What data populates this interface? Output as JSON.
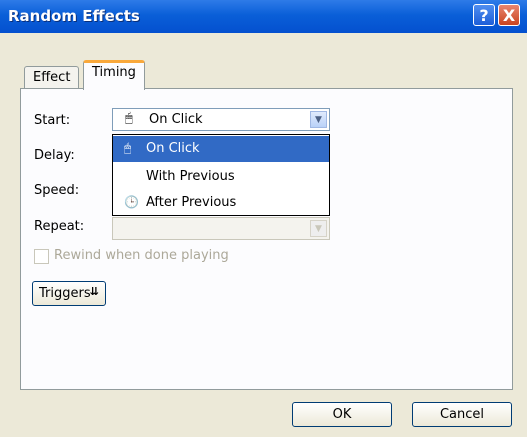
{
  "window": {
    "title": "Random Effects"
  },
  "titlebar": {
    "help_glyph": "?",
    "close_glyph": "X"
  },
  "tabs": [
    {
      "label": "Effect",
      "active": false
    },
    {
      "label": "Timing",
      "active": true
    }
  ],
  "fields": {
    "start_label": "Start:",
    "delay_label": "Delay:",
    "speed_label": "Speed:",
    "repeat_label": "Repeat:"
  },
  "start_select": {
    "value": "On Click",
    "icon": "mouse-icon"
  },
  "dropdown": {
    "options": [
      {
        "label": "On Click",
        "icon": "mouse-icon",
        "selected": true
      },
      {
        "label": "With Previous",
        "icon": ""
      },
      {
        "label": "After Previous",
        "icon": "clock-icon"
      }
    ]
  },
  "rewind": {
    "label": "Rewind when done playing",
    "checked": false,
    "enabled": false
  },
  "triggers_button": {
    "label": "Triggers"
  },
  "buttons": {
    "ok": "OK",
    "cancel": "Cancel"
  },
  "colors": {
    "titlebar": "#0a5fd8",
    "selection": "#316ac5",
    "dialog_bg": "#ece9d8"
  }
}
